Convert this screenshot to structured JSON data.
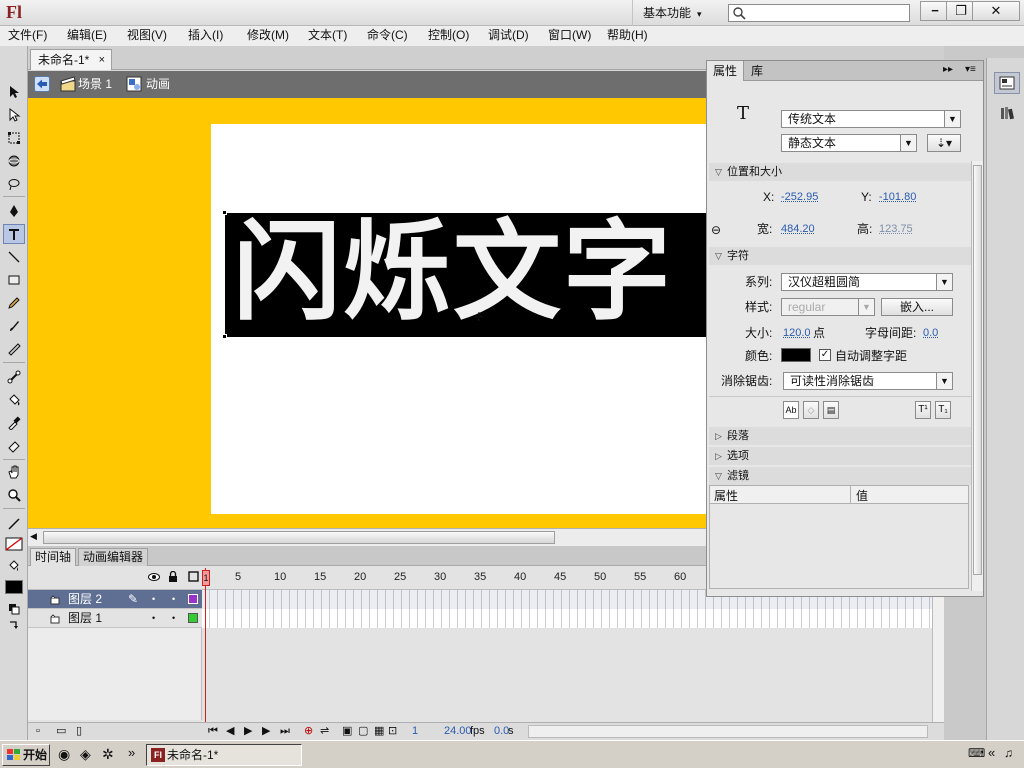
{
  "app": {
    "logo": "Fl"
  },
  "titlebar": {
    "workspace": "基本功能",
    "search_placeholder": ""
  },
  "menu": [
    "文件(F)",
    "编辑(E)",
    "视图(V)",
    "插入(I)",
    "修改(M)",
    "文本(T)",
    "命令(C)",
    "控制(O)",
    "调试(D)",
    "窗口(W)",
    "帮助(H)"
  ],
  "document": {
    "tab": "未命名-1*",
    "close": "×"
  },
  "editbar": {
    "scene": "场景 1",
    "symbol": "动画"
  },
  "stage": {
    "text": "闪烁文字"
  },
  "timeline": {
    "tabs": [
      "时间轴",
      "动画编辑器"
    ],
    "ruler": [
      "1",
      "5",
      "10",
      "15",
      "20",
      "25",
      "30",
      "35",
      "40",
      "45",
      "50",
      "55",
      "60"
    ],
    "layers": [
      {
        "name": "图层 2",
        "color": "#9933cc",
        "selected": true
      },
      {
        "name": "图层 1",
        "color": "#33cc33",
        "selected": false
      }
    ],
    "footer": {
      "frame": "1",
      "fps": "24.00",
      "fps_unit": "fps",
      "time": "0.0",
      "time_unit": "s"
    }
  },
  "properties": {
    "tabs": [
      "属性",
      "库"
    ],
    "text_type": "传统文本",
    "text_kind": "静态文本",
    "pos_section": "位置和大小",
    "x_label": "X:",
    "x_value": "-252.95",
    "y_label": "Y:",
    "y_value": "-101.80",
    "w_label": "宽:",
    "w_value": "484.20",
    "h_label": "高:",
    "h_value": "123.75",
    "char_section": "字符",
    "family_label": "系列:",
    "family_value": "汉仪超粗圆简",
    "style_label": "样式:",
    "style_value": "regular",
    "embed_button": "嵌入...",
    "size_label": "大小:",
    "size_value": "120.0",
    "size_unit": "点",
    "spacing_label": "字母间距:",
    "spacing_value": "0.0",
    "color_label": "颜色:",
    "color_value": "#000000",
    "autokern_label": "自动调整字距",
    "autokern_checked": true,
    "aa_label": "消除锯齿:",
    "aa_value": "可读性消除锯齿",
    "paragraph_section": "段落",
    "options_section": "选项",
    "filters_section": "滤镜",
    "filter_col_prop": "属性",
    "filter_col_value": "值"
  },
  "taskbar": {
    "start": "开始",
    "task": "未命名-1*"
  },
  "colors": {
    "stage_bg": "#ffc800",
    "accent_red": "#8a2222"
  }
}
